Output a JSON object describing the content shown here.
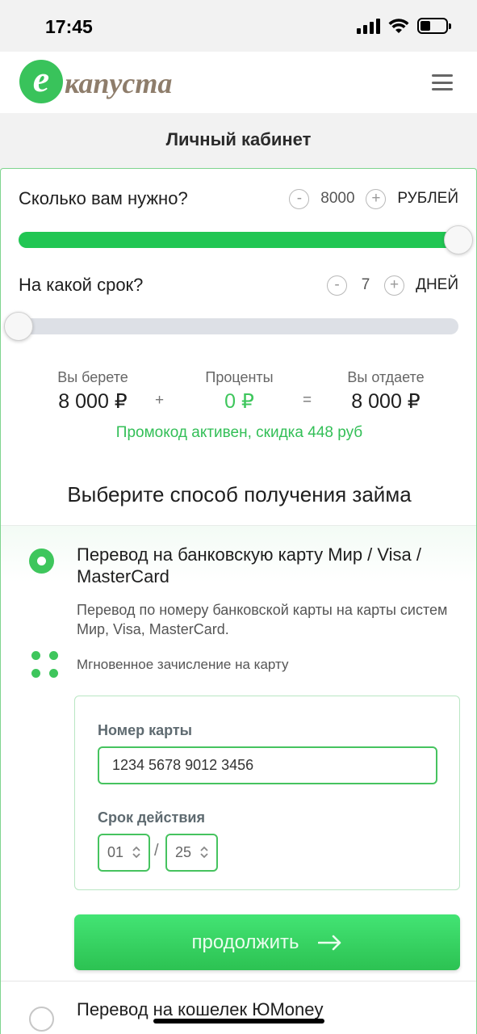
{
  "status_bar": {
    "time": "17:45"
  },
  "header": {
    "logo_letter": "е",
    "logo_text": "капуста"
  },
  "page": {
    "title": "Личный кабинет"
  },
  "calculator": {
    "amount": {
      "label": "Сколько вам нужно?",
      "value": "8000",
      "unit": "РУБЛЕЙ",
      "minus": "-",
      "plus": "+",
      "fill_percent": 100
    },
    "term": {
      "label": "На какой срок?",
      "value": "7",
      "unit": "ДНЕЙ",
      "minus": "-",
      "plus": "+",
      "fill_percent": 0
    },
    "summary": {
      "take_label": "Вы берете",
      "take_value": "8 000 ₽",
      "plus_sign": "+",
      "interest_label": "Проценты",
      "interest_value": "0 ₽",
      "equals_sign": "=",
      "return_label": "Вы отдаете",
      "return_value": "8 000 ₽"
    },
    "promo_text": "Промокод активен, скидка 448 руб"
  },
  "payout": {
    "section_title": "Выберите способ получения займа",
    "card_option": {
      "title": "Перевод на банковскую карту Мир / Visa / MasterCard",
      "description": "Перевод по номеру банковской карты на карты систем Мир, Visa, MasterCard.",
      "feature": "Мгновенное зачисление на карту",
      "selected": true,
      "form": {
        "card_number_label": "Номер карты",
        "card_number_value": "1234 5678 9012 3456",
        "expiry_label": "Срок действия",
        "expiry_month": "01",
        "expiry_separator": "/",
        "expiry_year": "25"
      },
      "continue_label": "продолжить"
    },
    "yoomoney_option": {
      "title": "Перевод на кошелек ЮMoney",
      "selected": false
    }
  },
  "colors": {
    "accent_green": "#3ec65c",
    "slider_fill": "#21c653",
    "track": "#dde0e6",
    "logo_brown": "#8e7d6b"
  },
  "icons": [
    "signal-icon",
    "wifi-icon",
    "battery-icon",
    "menu-icon",
    "radio-selected-icon",
    "radio-unselected-icon",
    "dots-icon",
    "chevron-updown-icon",
    "arrow-right-icon"
  ]
}
